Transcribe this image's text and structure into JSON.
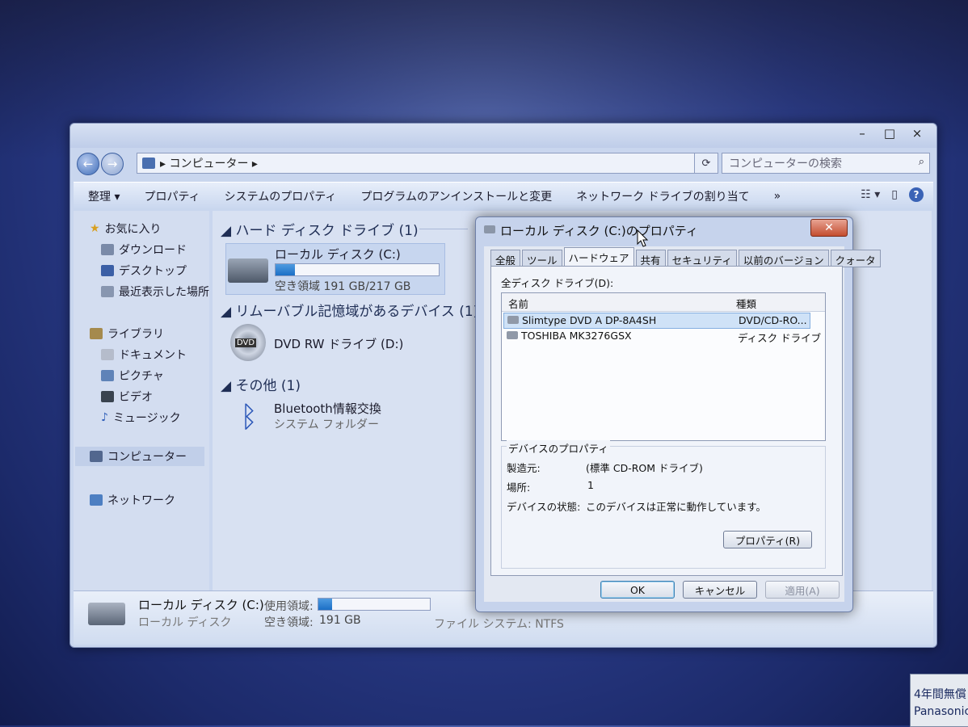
{
  "window": {
    "controls": {
      "minimize": "–",
      "maximize": "□",
      "close": "×"
    }
  },
  "nav": {
    "back_icon": "←",
    "forward_icon": "→",
    "address_path": "コンピューター",
    "refresh_icon": "⟳",
    "search_placeholder": "コンピューターの検索"
  },
  "toolbar": {
    "items": [
      "整理 ▾",
      "プロパティ",
      "システムのプロパティ",
      "プログラムのアンインストールと変更",
      "ネットワーク ドライブの割り当て",
      "»"
    ],
    "help": "?"
  },
  "sidebar": {
    "favorites": "お気に入り",
    "fav_items": [
      "ダウンロード",
      "デスクトップ",
      "最近表示した場所"
    ],
    "libraries": "ライブラリ",
    "lib_items": [
      "ドキュメント",
      "ピクチャ",
      "ビデオ",
      "ミュージック"
    ],
    "computer": "コンピューター",
    "network": "ネットワーク"
  },
  "content": {
    "groups": [
      {
        "label": "ハード ディスク ドライブ (1)"
      },
      {
        "label": "リムーバブル記憶域があるデバイス (1)"
      },
      {
        "label": "その他 (1)"
      }
    ],
    "local_disk": {
      "name": "ローカル ディスク (C:)",
      "free": "空き領域 191 GB/217 GB",
      "used_fraction": 0.12
    },
    "dvd": {
      "name": "DVD RW ドライブ (D:)",
      "badge": "DVD"
    },
    "bluetooth": {
      "name": "Bluetooth情報交換",
      "sub": "システム フォルダー"
    }
  },
  "statusbar": {
    "name": "ローカル ディスク (C:)",
    "used_label": "使用領域:",
    "type": "ローカル ディスク",
    "free_label": "空き領域:",
    "free_value": "191 GB",
    "fs": "ファイル システム: NTFS",
    "used_fraction": 0.12
  },
  "dialog": {
    "title": "ローカル ディスク (C:)のプロパティ",
    "close": "✕",
    "tabs": [
      "全般",
      "ツール",
      "ハードウェア",
      "共有",
      "セキュリティ",
      "以前のバージョン",
      "クォータ"
    ],
    "active_tab": 2,
    "drives_label": "全ディスク ドライブ(D):",
    "col_name": "名前",
    "col_type": "種類",
    "rows": [
      {
        "name": "Slimtype DVD A  DP-8A4SH",
        "type": "DVD/CD-RO..."
      },
      {
        "name": "TOSHIBA MK3276GSX",
        "type": "ディスク ドライブ"
      }
    ],
    "props_group": "デバイスのプロパティ",
    "manufacturer_label": "製造元:",
    "manufacturer": "(標準 CD-ROM ドライブ)",
    "location_label": "場所:",
    "location": "1",
    "status_label": "デバイスの状態:",
    "status": "このデバイスは正常に動作しています。",
    "properties_btn": "プロパティ(R)",
    "ok": "OK",
    "cancel": "キャンセル",
    "apply": "適用(A)"
  },
  "sticker": {
    "line1": "4年間無償",
    "line2": "Panasonic"
  }
}
